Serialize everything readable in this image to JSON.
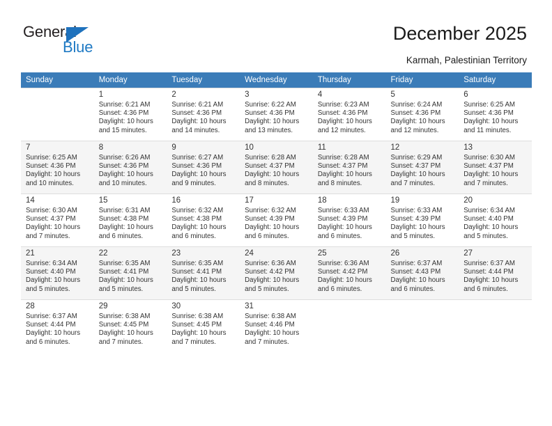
{
  "brand": {
    "name_top": "General",
    "name_bottom": "Blue",
    "triangle_color": "#1f72bd",
    "blue_color": "#1f7ac4"
  },
  "header": {
    "title": "December 2025",
    "subtitle": "Karmah, Palestinian Territory"
  },
  "calendar": {
    "header_bg": "#3b7cb8",
    "alt_row_bg": "#f5f5f5",
    "weekdays": [
      "Sunday",
      "Monday",
      "Tuesday",
      "Wednesday",
      "Thursday",
      "Friday",
      "Saturday"
    ],
    "weeks": [
      [
        {
          "day": "",
          "sunrise": "",
          "sunset": "",
          "daylight1": "",
          "daylight2": ""
        },
        {
          "day": "1",
          "sunrise": "Sunrise: 6:21 AM",
          "sunset": "Sunset: 4:36 PM",
          "daylight1": "Daylight: 10 hours",
          "daylight2": "and 15 minutes."
        },
        {
          "day": "2",
          "sunrise": "Sunrise: 6:21 AM",
          "sunset": "Sunset: 4:36 PM",
          "daylight1": "Daylight: 10 hours",
          "daylight2": "and 14 minutes."
        },
        {
          "day": "3",
          "sunrise": "Sunrise: 6:22 AM",
          "sunset": "Sunset: 4:36 PM",
          "daylight1": "Daylight: 10 hours",
          "daylight2": "and 13 minutes."
        },
        {
          "day": "4",
          "sunrise": "Sunrise: 6:23 AM",
          "sunset": "Sunset: 4:36 PM",
          "daylight1": "Daylight: 10 hours",
          "daylight2": "and 12 minutes."
        },
        {
          "day": "5",
          "sunrise": "Sunrise: 6:24 AM",
          "sunset": "Sunset: 4:36 PM",
          "daylight1": "Daylight: 10 hours",
          "daylight2": "and 12 minutes."
        },
        {
          "day": "6",
          "sunrise": "Sunrise: 6:25 AM",
          "sunset": "Sunset: 4:36 PM",
          "daylight1": "Daylight: 10 hours",
          "daylight2": "and 11 minutes."
        }
      ],
      [
        {
          "day": "7",
          "sunrise": "Sunrise: 6:25 AM",
          "sunset": "Sunset: 4:36 PM",
          "daylight1": "Daylight: 10 hours",
          "daylight2": "and 10 minutes."
        },
        {
          "day": "8",
          "sunrise": "Sunrise: 6:26 AM",
          "sunset": "Sunset: 4:36 PM",
          "daylight1": "Daylight: 10 hours",
          "daylight2": "and 10 minutes."
        },
        {
          "day": "9",
          "sunrise": "Sunrise: 6:27 AM",
          "sunset": "Sunset: 4:36 PM",
          "daylight1": "Daylight: 10 hours",
          "daylight2": "and 9 minutes."
        },
        {
          "day": "10",
          "sunrise": "Sunrise: 6:28 AM",
          "sunset": "Sunset: 4:37 PM",
          "daylight1": "Daylight: 10 hours",
          "daylight2": "and 8 minutes."
        },
        {
          "day": "11",
          "sunrise": "Sunrise: 6:28 AM",
          "sunset": "Sunset: 4:37 PM",
          "daylight1": "Daylight: 10 hours",
          "daylight2": "and 8 minutes."
        },
        {
          "day": "12",
          "sunrise": "Sunrise: 6:29 AM",
          "sunset": "Sunset: 4:37 PM",
          "daylight1": "Daylight: 10 hours",
          "daylight2": "and 7 minutes."
        },
        {
          "day": "13",
          "sunrise": "Sunrise: 6:30 AM",
          "sunset": "Sunset: 4:37 PM",
          "daylight1": "Daylight: 10 hours",
          "daylight2": "and 7 minutes."
        }
      ],
      [
        {
          "day": "14",
          "sunrise": "Sunrise: 6:30 AM",
          "sunset": "Sunset: 4:37 PM",
          "daylight1": "Daylight: 10 hours",
          "daylight2": "and 7 minutes."
        },
        {
          "day": "15",
          "sunrise": "Sunrise: 6:31 AM",
          "sunset": "Sunset: 4:38 PM",
          "daylight1": "Daylight: 10 hours",
          "daylight2": "and 6 minutes."
        },
        {
          "day": "16",
          "sunrise": "Sunrise: 6:32 AM",
          "sunset": "Sunset: 4:38 PM",
          "daylight1": "Daylight: 10 hours",
          "daylight2": "and 6 minutes."
        },
        {
          "day": "17",
          "sunrise": "Sunrise: 6:32 AM",
          "sunset": "Sunset: 4:39 PM",
          "daylight1": "Daylight: 10 hours",
          "daylight2": "and 6 minutes."
        },
        {
          "day": "18",
          "sunrise": "Sunrise: 6:33 AM",
          "sunset": "Sunset: 4:39 PM",
          "daylight1": "Daylight: 10 hours",
          "daylight2": "and 6 minutes."
        },
        {
          "day": "19",
          "sunrise": "Sunrise: 6:33 AM",
          "sunset": "Sunset: 4:39 PM",
          "daylight1": "Daylight: 10 hours",
          "daylight2": "and 5 minutes."
        },
        {
          "day": "20",
          "sunrise": "Sunrise: 6:34 AM",
          "sunset": "Sunset: 4:40 PM",
          "daylight1": "Daylight: 10 hours",
          "daylight2": "and 5 minutes."
        }
      ],
      [
        {
          "day": "21",
          "sunrise": "Sunrise: 6:34 AM",
          "sunset": "Sunset: 4:40 PM",
          "daylight1": "Daylight: 10 hours",
          "daylight2": "and 5 minutes."
        },
        {
          "day": "22",
          "sunrise": "Sunrise: 6:35 AM",
          "sunset": "Sunset: 4:41 PM",
          "daylight1": "Daylight: 10 hours",
          "daylight2": "and 5 minutes."
        },
        {
          "day": "23",
          "sunrise": "Sunrise: 6:35 AM",
          "sunset": "Sunset: 4:41 PM",
          "daylight1": "Daylight: 10 hours",
          "daylight2": "and 5 minutes."
        },
        {
          "day": "24",
          "sunrise": "Sunrise: 6:36 AM",
          "sunset": "Sunset: 4:42 PM",
          "daylight1": "Daylight: 10 hours",
          "daylight2": "and 5 minutes."
        },
        {
          "day": "25",
          "sunrise": "Sunrise: 6:36 AM",
          "sunset": "Sunset: 4:42 PM",
          "daylight1": "Daylight: 10 hours",
          "daylight2": "and 6 minutes."
        },
        {
          "day": "26",
          "sunrise": "Sunrise: 6:37 AM",
          "sunset": "Sunset: 4:43 PM",
          "daylight1": "Daylight: 10 hours",
          "daylight2": "and 6 minutes."
        },
        {
          "day": "27",
          "sunrise": "Sunrise: 6:37 AM",
          "sunset": "Sunset: 4:44 PM",
          "daylight1": "Daylight: 10 hours",
          "daylight2": "and 6 minutes."
        }
      ],
      [
        {
          "day": "28",
          "sunrise": "Sunrise: 6:37 AM",
          "sunset": "Sunset: 4:44 PM",
          "daylight1": "Daylight: 10 hours",
          "daylight2": "and 6 minutes."
        },
        {
          "day": "29",
          "sunrise": "Sunrise: 6:38 AM",
          "sunset": "Sunset: 4:45 PM",
          "daylight1": "Daylight: 10 hours",
          "daylight2": "and 7 minutes."
        },
        {
          "day": "30",
          "sunrise": "Sunrise: 6:38 AM",
          "sunset": "Sunset: 4:45 PM",
          "daylight1": "Daylight: 10 hours",
          "daylight2": "and 7 minutes."
        },
        {
          "day": "31",
          "sunrise": "Sunrise: 6:38 AM",
          "sunset": "Sunset: 4:46 PM",
          "daylight1": "Daylight: 10 hours",
          "daylight2": "and 7 minutes."
        },
        {
          "day": "",
          "sunrise": "",
          "sunset": "",
          "daylight1": "",
          "daylight2": ""
        },
        {
          "day": "",
          "sunrise": "",
          "sunset": "",
          "daylight1": "",
          "daylight2": ""
        },
        {
          "day": "",
          "sunrise": "",
          "sunset": "",
          "daylight1": "",
          "daylight2": ""
        }
      ]
    ]
  }
}
